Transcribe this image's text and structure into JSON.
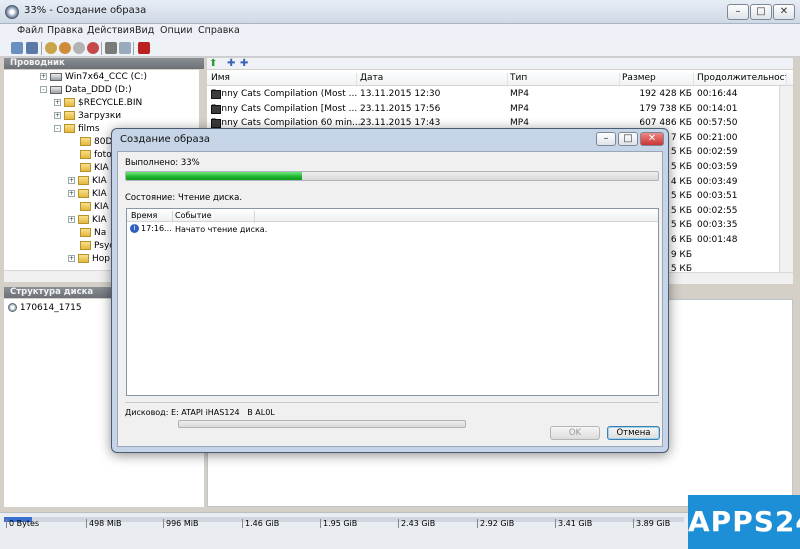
{
  "window": {
    "title": "33% - Создание образа"
  },
  "menu": [
    "Файл",
    "Правка",
    "Действия",
    "Вид",
    "Опции",
    "Справка"
  ],
  "explorer": {
    "title": "Проводник"
  },
  "tree": [
    {
      "label": "Win7x64_CCC (C:)",
      "type": "drive",
      "expander": "+"
    },
    {
      "label": "Data_DDD (D:)",
      "type": "drive",
      "expander": "-"
    },
    {
      "label": "$RECYCLE.BIN",
      "type": "folder",
      "expander": "+"
    },
    {
      "label": "Загрузки",
      "type": "folder",
      "expander": "+"
    },
    {
      "label": "films",
      "type": "folder",
      "expander": "-"
    },
    {
      "label": "80D",
      "type": "folder",
      "expander": ""
    },
    {
      "label": "foto",
      "type": "folder",
      "expander": ""
    },
    {
      "label": "KIA",
      "type": "folder",
      "expander": ""
    },
    {
      "label": "KIA",
      "type": "folder",
      "expander": "+"
    },
    {
      "label": "KIA",
      "type": "folder",
      "expander": "+"
    },
    {
      "label": "KIA",
      "type": "folder",
      "expander": ""
    },
    {
      "label": "KIA",
      "type": "folder",
      "expander": "+"
    },
    {
      "label": "Na",
      "type": "folder",
      "expander": ""
    },
    {
      "label": "Psyc",
      "type": "folder",
      "expander": ""
    },
    {
      "label": "Hop",
      "type": "folder",
      "expander": "+"
    }
  ],
  "files": {
    "columns": [
      "Имя",
      "Дата",
      "Тип",
      "Размер",
      "Продолжительност"
    ],
    "rows": [
      {
        "name": "Funny Cats Compilation (Most ...",
        "date": "13.11.2015 12:30",
        "type": "MP4",
        "size": "192 428 КБ",
        "duration": "00:16:44"
      },
      {
        "name": "Funny Cats Compilation [Most ...",
        "date": "23.11.2015 17:56",
        "type": "MP4",
        "size": "179 738 КБ",
        "duration": "00:14:01"
      },
      {
        "name": "Funny Cats Compilation 60 min...",
        "date": "23.11.2015 17:43",
        "type": "MP4",
        "size": "607 486 КБ",
        "duration": "00:57:50"
      },
      {
        "name": "",
        "date": "",
        "type": "",
        "size": "7 КБ",
        "duration": "00:21:00"
      },
      {
        "name": "",
        "date": "",
        "type": "",
        "size": "5 КБ",
        "duration": "00:02:59"
      },
      {
        "name": "",
        "date": "",
        "type": "",
        "size": "5 КБ",
        "duration": "00:03:59"
      },
      {
        "name": "",
        "date": "",
        "type": "",
        "size": "4 КБ",
        "duration": "00:03:49"
      },
      {
        "name": "",
        "date": "",
        "type": "",
        "size": "5 КБ",
        "duration": "00:03:51"
      },
      {
        "name": "",
        "date": "",
        "type": "",
        "size": "5 КБ",
        "duration": "00:02:55"
      },
      {
        "name": "",
        "date": "",
        "type": "",
        "size": "5 КБ",
        "duration": "00:03:35"
      },
      {
        "name": "",
        "date": "",
        "type": "",
        "size": "6 КБ",
        "duration": "00:01:48"
      },
      {
        "name": "",
        "date": "",
        "type": "",
        "size": "9 КБ",
        "duration": ""
      },
      {
        "name": "",
        "date": "",
        "type": "",
        "size": "5 КБ",
        "duration": ""
      }
    ]
  },
  "disk_structure": {
    "title": "Структура диска",
    "item": "170614_1715"
  },
  "ruler": [
    "0 Bytes",
    "498 MiB",
    "996 MiB",
    "1.46 GiB",
    "1.95 GiB",
    "2.43 GiB",
    "2.92 GiB",
    "3.41 GiB",
    "3.89 GiB"
  ],
  "watermark": "APPS24",
  "dialog": {
    "title": "Создание образа",
    "done_label": "Выполнено: 33%",
    "progress": 0.33,
    "status_label": "Состояние: Чтение диска.",
    "log_columns": [
      "Время",
      "Событие"
    ],
    "log": [
      {
        "time": "17:16...",
        "event": "Начато чтение диска."
      }
    ],
    "drive_label": "Дисковод: E: ATAPI iHAS124   B AL0L",
    "ok": "OK",
    "cancel": "Отмена"
  }
}
